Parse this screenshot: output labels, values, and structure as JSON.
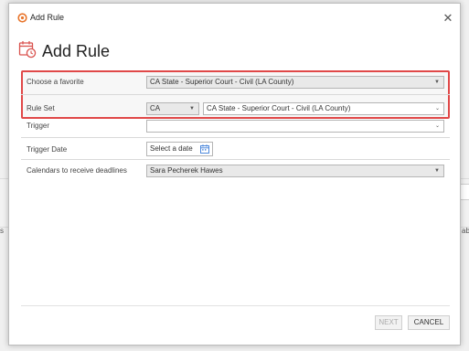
{
  "dialog": {
    "title": "Add Rule",
    "header_title": "Add Rule"
  },
  "form": {
    "favorite": {
      "label": "Choose a favorite",
      "value": "CA State - Superior Court - Civil (LA County)"
    },
    "rule_set": {
      "label": "Rule Set",
      "state_value": "CA",
      "value": "CA State - Superior Court - Civil (LA County)"
    },
    "trigger": {
      "label": "Trigger",
      "value": ""
    },
    "trigger_date": {
      "label": "Trigger Date",
      "placeholder": "Select a date"
    },
    "calendars": {
      "label": "Calendars to receive deadlines",
      "value": "Sara Pecherek Hawes"
    }
  },
  "buttons": {
    "next": "NEXT",
    "cancel": "CANCEL"
  },
  "background": {
    "left_fragment": "s",
    "right_fragment": "ab"
  },
  "colors": {
    "highlight": "#e04848",
    "accent": "#d9534f",
    "icon_blue": "#3b7dd8"
  }
}
